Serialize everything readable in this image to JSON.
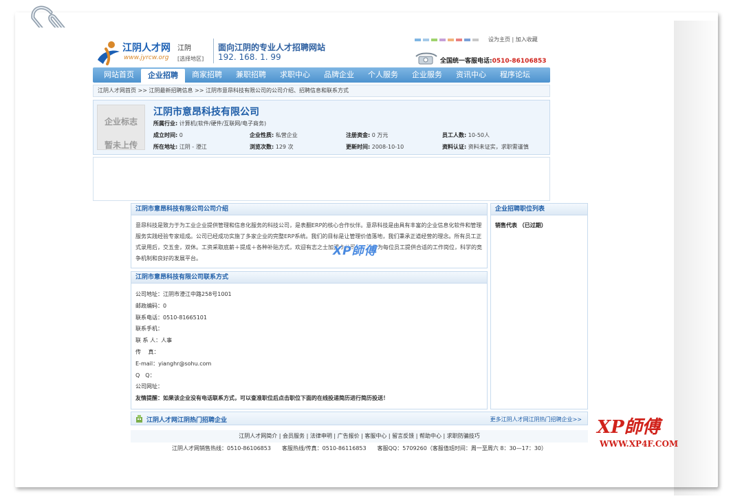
{
  "header": {
    "logo_name": "江阴人才网",
    "logo_url": "www.jyrcw.org",
    "city": "江阴",
    "city_switch": "[选择地区]",
    "slogan": "面向江阴的专业人才招聘网站",
    "ip": "192. 168. 1. 99",
    "top_links": "设为主页 | 加入收藏",
    "hotline_label": "全国统一客服电话:",
    "hotline_number": "0510-86106853",
    "dot_colors": [
      "#7fb6e3",
      "#a4c9e8",
      "#9fd36c",
      "#c6a0d8",
      "#f1b37b",
      "#e98080",
      "#7aa0d8",
      "#c8c8c8"
    ]
  },
  "nav": {
    "items": [
      "网站首页",
      "企业招聘",
      "商家招聘",
      "兼职招聘",
      "求职中心",
      "品牌企业",
      "个人服务",
      "企业服务",
      "资讯中心",
      "程序论坛"
    ],
    "active_index": 1
  },
  "breadcrumb": "江阴人才网首页 >> 江阴最新招聘信息 >> 江阴市意昂科技有限公司的公司介绍、招聘信息和联系方式",
  "company": {
    "logo_placeholder_1": "企业标志",
    "logo_placeholder_2": "暂未上传",
    "name": "江阴市意昂科技有限公司",
    "industry_label": "所属行业:",
    "industry": "计算机(软件/硬件/互联网/电子商务)",
    "founded_label": "成立时间:",
    "founded": "0",
    "nature_label": "企业性质:",
    "nature": "私营企业",
    "capital_label": "注册资金:",
    "capital": "0 万元",
    "staff_label": "员工人数:",
    "staff": "10-50人",
    "address_label": "所在地址:",
    "address": "江阴 - 澄江",
    "views_label": "浏览次数:",
    "views": "129 次",
    "updated_label": "更新时间:",
    "updated": "2008-10-10",
    "cert_label": "资料认证:",
    "cert": "资料未证实，求职需谨慎"
  },
  "intro": {
    "title": "江阴市意昂科技有限公司公司介绍",
    "text": "意昂科技是致力于为工业企业提供管理和信息化服务的科技公司，是表翻ERP的核心合作伙伴。意昂科技是由具有丰富的企业信息化软件和管理服务实践经验专家组成。公司已经成功实施了多家企业的完整ERP系统。我们的目标是让管理价值落地，我们秉承正道经营的理念。所有员工正式录用后，交五金，双休。工资采取底薪＋提成＋各种补贴方式，欢迎有志之士加盟本公司，公司将为每位员工提供合适的工作岗位，科学的竞争机制和良好的发展平台。"
  },
  "jobs": {
    "title": "企业招聘职位列表",
    "items": [
      "销售代表 （已过期）"
    ]
  },
  "contact": {
    "title": "江阴市意昂科技有限公司联系方式",
    "lines": [
      "公司地址：江阴市澄江中路258号1001",
      "邮政编码：0",
      "联系电话：0510-81665101",
      "联系手机：",
      "联 系 人：人事",
      "传　 真：",
      "E-mail：yianghr@sohu.com",
      "Q　Q：",
      "公司网址：",
      "友情提醒：如果该企业没有电话联系方式，可以查准职位后点击职位下面的在线投递简历进行简历投送！"
    ]
  },
  "hot": {
    "title": "江阴人才网江阴热门招聘企业",
    "more": "更多江阴人才网江阴热门招聘企业>>"
  },
  "footer": {
    "links": "江阴人才网简介 | 会员服务 | 法律申明 | 广告报价 | 客服中心 | 留言反馈 | 帮助中心 | 求职防骗技巧",
    "copyright": "江阴人才网销售热线：0510-86106853　　客服热线/传真：0510-86116853　　客服QQ：5709260（客服值班时间：周一至周六 8：30—17：30）"
  },
  "watermark": "XP師傅",
  "brand": {
    "name": "XP師傅",
    "url": "WWW.XP4F.COM"
  }
}
